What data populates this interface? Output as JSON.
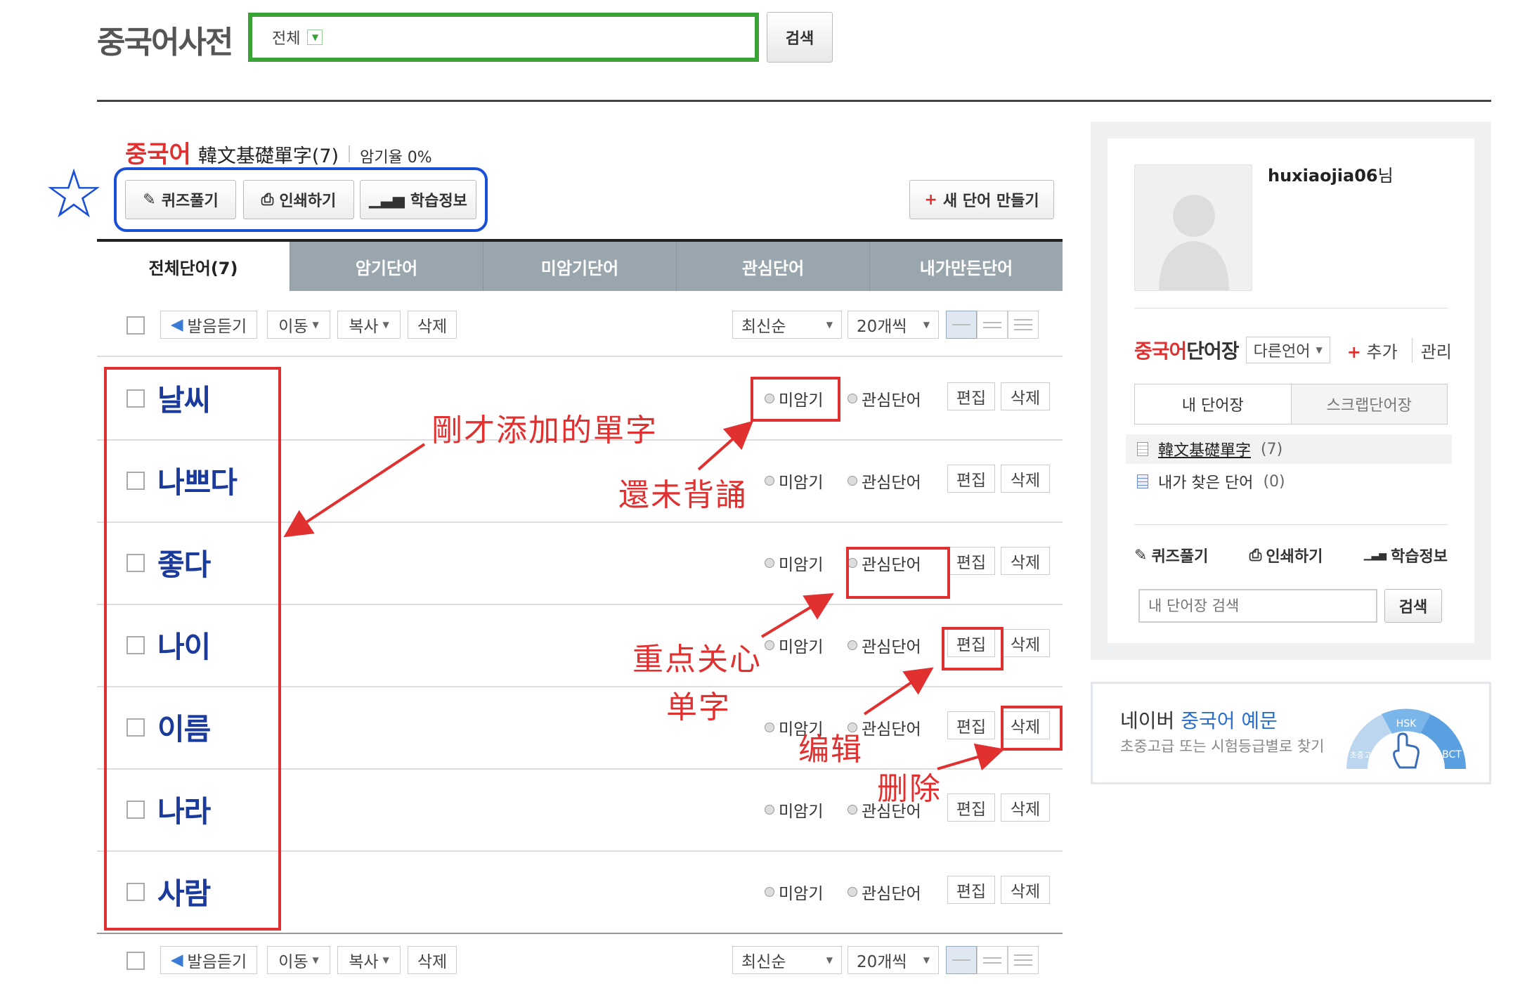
{
  "header": {
    "logo": "중국어사전",
    "search_scope": "전체",
    "search_button": "검색"
  },
  "wordbook": {
    "lang": "중국어",
    "name": "韓文基礎單字(7)",
    "memorize_rate": "암기율 0%",
    "tools": {
      "quiz": "퀴즈풀기",
      "print": "인쇄하기",
      "study_info": "학습정보"
    },
    "new_word": "새 단어 만들기"
  },
  "tabs": [
    "전체단어(7)",
    "암기단어",
    "미암기단어",
    "관심단어",
    "내가만든단어"
  ],
  "toolbar": {
    "listen": "발음듣기",
    "move": "이동",
    "copy": "복사",
    "delete": "삭제",
    "sort": "최신순",
    "per_page": "20개씩"
  },
  "row_labels": {
    "not_memorized": "미암기",
    "interest": "관심단어",
    "edit": "편집",
    "delete": "삭제"
  },
  "words": [
    "날씨",
    "나쁘다",
    "좋다",
    "나이",
    "이름",
    "나라",
    "사람"
  ],
  "annotations": {
    "added": "剛才添加的單字",
    "not_yet": "還未背誦",
    "focus_line1": "重点关心",
    "focus_line2": "单字",
    "edit": "编辑",
    "delete": "删除",
    "star": "☆"
  },
  "sidebar": {
    "username": "huxiaojia06",
    "username_suffix": "님",
    "wb_lang": "중국어",
    "wb_label": "단어장",
    "other_lang": "다른언어",
    "add": "추가",
    "manage": "관리",
    "tab_mine": "내 단어장",
    "tab_scrap": "스크랩단어장",
    "list": [
      {
        "name": "韓文基礎單字",
        "count": "(7)"
      },
      {
        "name": "내가 찾은 단어",
        "count": "(0)"
      }
    ],
    "quiz": "퀴즈풀기",
    "print": "인쇄하기",
    "study_info": "학습정보",
    "search_placeholder": "내 단어장 검색",
    "search_button": "검색"
  },
  "banner": {
    "title_prefix": "네이버 ",
    "title_highlight": "중국어 예문",
    "subtitle": "초중고급 또는 시험등급별로 찾기",
    "hsk": "HSK",
    "bct": "BCT",
    "level": "초중고"
  },
  "colors": {
    "accent_red": "#e03030",
    "annotation_blue": "#1a4fd8",
    "search_green": "#3aa335",
    "word_blue": "#1a3a9c"
  }
}
